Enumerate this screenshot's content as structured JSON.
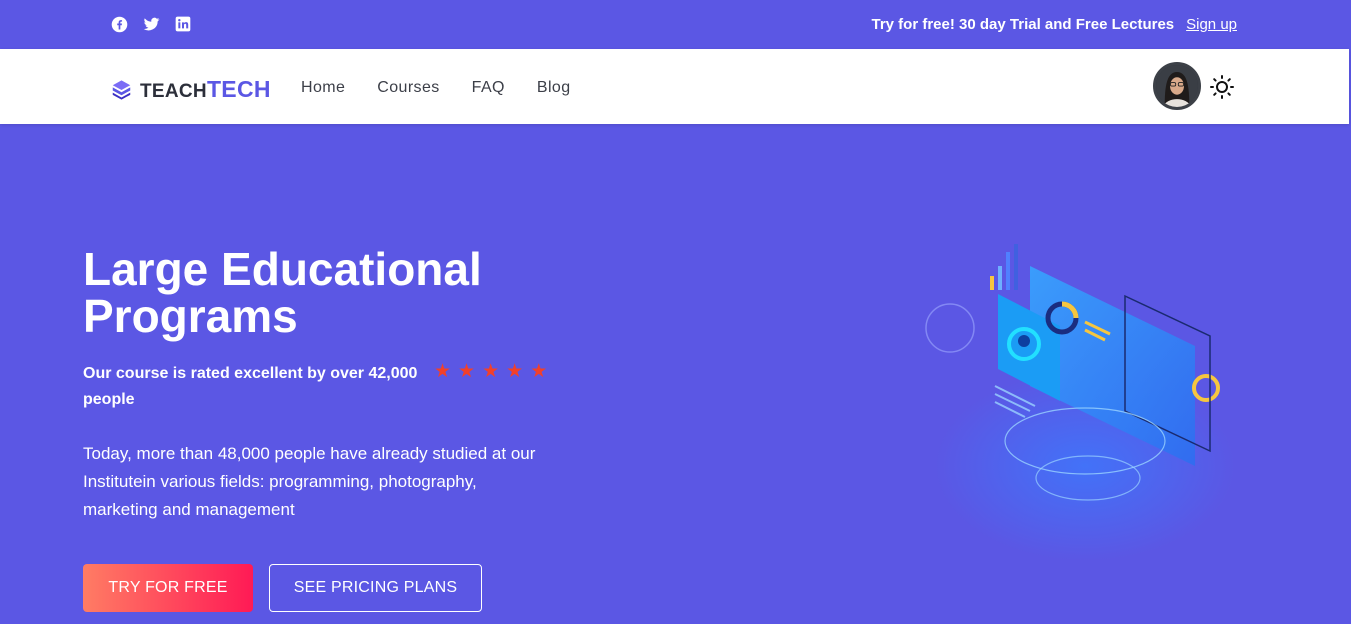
{
  "topbar": {
    "social": [
      {
        "icon": "facebook-icon"
      },
      {
        "icon": "twitter-icon"
      },
      {
        "icon": "linkedin-icon"
      }
    ],
    "promo_text": "Try for free! 30 day Trial and Free Lectures",
    "signup_label": "Sign up"
  },
  "navbar": {
    "logo_part1": "TEACH",
    "logo_part2": "TECH",
    "links": [
      "Home",
      "Courses",
      "FAQ",
      "Blog"
    ],
    "theme_icon": "sun-icon"
  },
  "hero": {
    "title_line1": "Large Educational",
    "title_line2": "Programs",
    "rating_text": "Our course is rated excellent by over 42,000 people",
    "stars": 5,
    "description": "Today, more than 48,000 people have already studied at our Institutein various fields: programming, photography, marketing and management",
    "primary_button": "TRY FOR FREE",
    "secondary_button": "SEE PRICING PLANS"
  },
  "colors": {
    "brand": "#5b57e4",
    "star": "#f2402a",
    "cta_gradient_start": "#ff7c64",
    "cta_gradient_end": "#ff1a55"
  }
}
